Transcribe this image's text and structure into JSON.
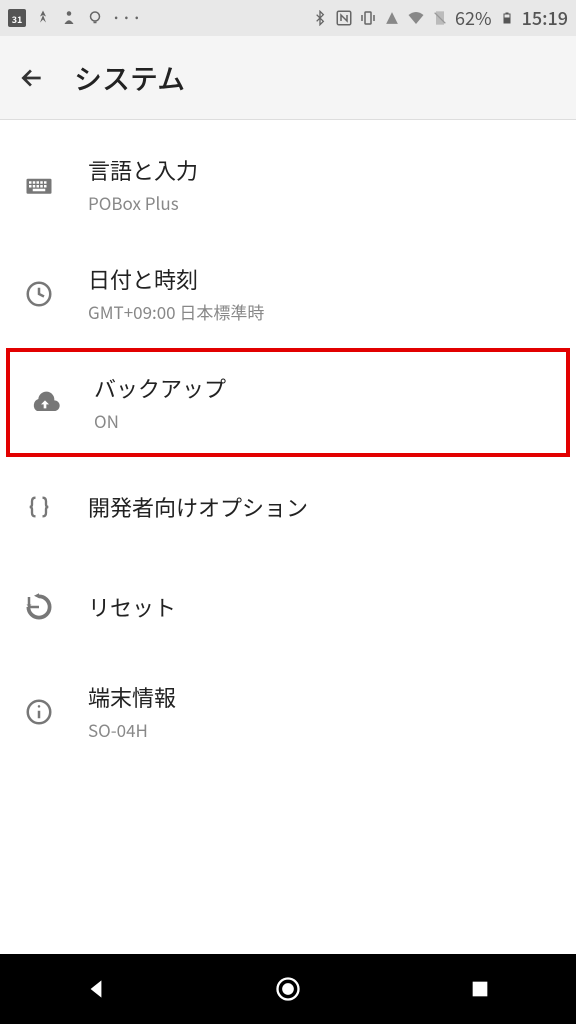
{
  "status_bar": {
    "calendar_day": "31",
    "battery_pct": "62%",
    "time": "15:19"
  },
  "app_bar": {
    "title": "システム"
  },
  "items": [
    {
      "title": "言語と入力",
      "sub": "POBox Plus",
      "icon": "keyboard"
    },
    {
      "title": "日付と時刻",
      "sub": "GMT+09:00 日本標準時",
      "icon": "clock"
    },
    {
      "title": "バックアップ",
      "sub": "ON",
      "icon": "cloud-upload",
      "highlighted": true
    },
    {
      "title": "開発者向けオプション",
      "sub": "",
      "icon": "braces"
    },
    {
      "title": "リセット",
      "sub": "",
      "icon": "reset"
    },
    {
      "title": "端末情報",
      "sub": "SO-04H",
      "icon": "info"
    }
  ]
}
